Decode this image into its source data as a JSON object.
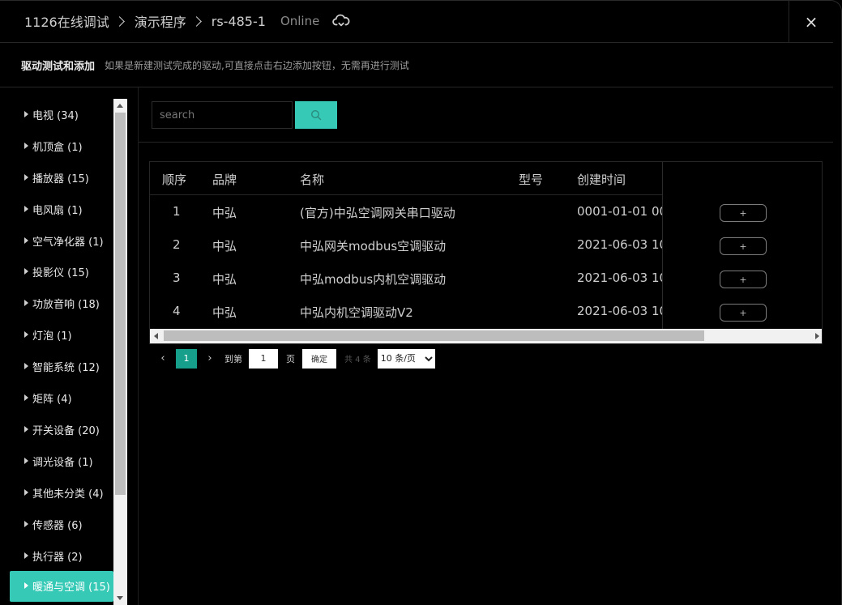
{
  "header": {
    "breadcrumbs": [
      "1126在线调试",
      "演示程序",
      "rs-485-1"
    ],
    "status": "Online",
    "close_label": "×"
  },
  "subheader": {
    "title": "驱动测试和添加",
    "description": "如果是新建测试完成的驱动,可直接点击右边添加按钮，无需再进行测试"
  },
  "sidebar": {
    "items": [
      {
        "label": "电视 (34)"
      },
      {
        "label": "机顶盒 (1)"
      },
      {
        "label": "播放器 (15)"
      },
      {
        "label": "电风扇 (1)"
      },
      {
        "label": "空气净化器 (1)"
      },
      {
        "label": "投影仪 (15)"
      },
      {
        "label": "功放音响 (18)"
      },
      {
        "label": "灯泡 (1)"
      },
      {
        "label": "智能系统 (12)"
      },
      {
        "label": "矩阵 (4)"
      },
      {
        "label": "开关设备 (20)"
      },
      {
        "label": "调光设备 (1)"
      },
      {
        "label": "其他未分类 (4)"
      },
      {
        "label": "传感器 (6)"
      },
      {
        "label": "执行器 (2)"
      },
      {
        "label": "暖通与空调 (15)"
      }
    ],
    "active_index": 15
  },
  "search": {
    "placeholder": "search",
    "value": ""
  },
  "table": {
    "columns": [
      "顺序",
      "品牌",
      "名称",
      "型号",
      "创建时间"
    ],
    "rows": [
      {
        "index": "1",
        "brand": "中弘",
        "name": "(官方)中弘空调网关串口驱动",
        "model": "",
        "created": "0001-01-01 00",
        "action": "+"
      },
      {
        "index": "2",
        "brand": "中弘",
        "name": "中弘网关modbus空调驱动",
        "model": "",
        "created": "2021-06-03 10",
        "action": "+"
      },
      {
        "index": "3",
        "brand": "中弘",
        "name": "中弘modbus内机空调驱动",
        "model": "",
        "created": "2021-06-03 10",
        "action": "+"
      },
      {
        "index": "4",
        "brand": "中弘",
        "name": "中弘内机空调驱动V2",
        "model": "",
        "created": "2021-06-03 10",
        "action": "+"
      }
    ]
  },
  "pagination": {
    "prev": "‹",
    "current_page": "1",
    "next": "›",
    "goto_label": "到第",
    "goto_value": "1",
    "page_label": "页",
    "confirm_label": "确定",
    "total_label": "共 4 条",
    "page_size_options": [
      "10 条/页"
    ],
    "page_size": "10 条/页"
  },
  "colors": {
    "accent": "#36c9b6",
    "page_active": "#16a08c",
    "background": "#000000"
  }
}
